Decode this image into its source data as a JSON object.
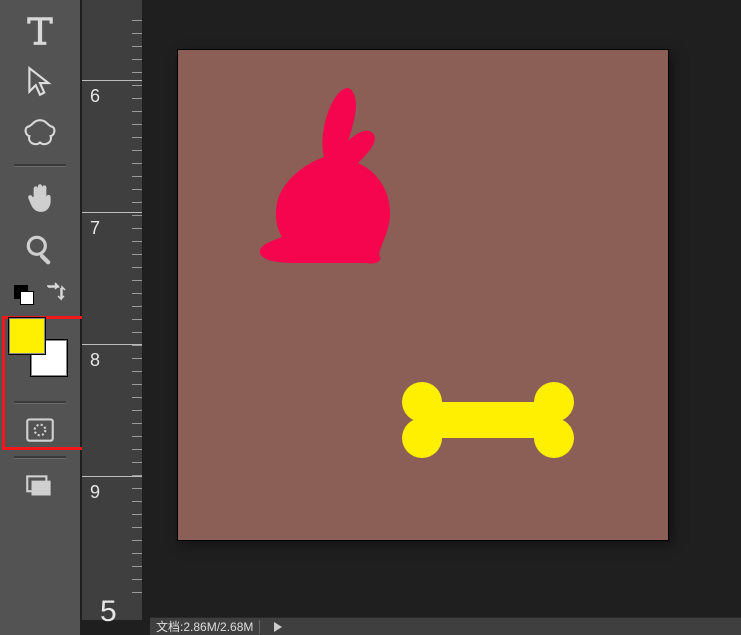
{
  "ruler": {
    "labels": [
      "6",
      "7",
      "8",
      "9"
    ],
    "bottom_char": "5"
  },
  "toolbar": {
    "tools": [
      {
        "name": "type-tool"
      },
      {
        "name": "path-selection-tool"
      },
      {
        "name": "custom-shape-tool"
      },
      {
        "name": "hand-tool"
      },
      {
        "name": "zoom-tool"
      }
    ],
    "below": [
      {
        "name": "quick-mask-toggle"
      },
      {
        "name": "screen-mode-button"
      }
    ]
  },
  "colors": {
    "foreground": "#ffef00",
    "background": "#ffffff",
    "canvas_fill": "#8b5f55",
    "rabbit": "#f5054d",
    "bone": "#ffef00"
  },
  "status": {
    "doc_label": "文档",
    "doc_size": ":2.86M/2.68M"
  }
}
